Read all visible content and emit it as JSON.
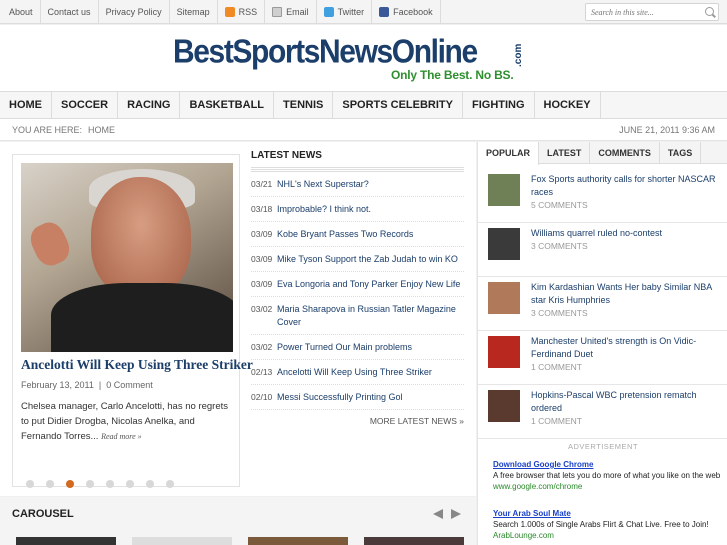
{
  "topnav": {
    "items": [
      "About",
      "Contact us",
      "Privacy Policy",
      "Sitemap"
    ],
    "rss": "RSS",
    "email": "Email",
    "twitter": "Twitter",
    "facebook": "Facebook",
    "search_placeholder": "Search in this site..."
  },
  "logo": {
    "name": "BestSportsNewsOnline",
    "tld": ".com",
    "tagline": "Only The Best. No BS."
  },
  "mainnav": [
    "HOME",
    "SOCCER",
    "RACING",
    "BASKETBALL",
    "TENNIS",
    "SPORTS CELEBRITY",
    "FIGHTING",
    "HOCKEY"
  ],
  "breadcrumb": {
    "label": "YOU ARE HERE:",
    "home": "HOME",
    "date": "JUNE 21, 2011 9:36 AM"
  },
  "featured": {
    "title": "Ancelotti Will Keep Using Three Striker",
    "date": "February 13, 2011",
    "comments": "0 Comment",
    "excerpt": "Chelsea manager, Carlo Ancelotti, has no regrets to put Didier Drogba, Nicolas Anelka, and Fernando Torres...",
    "read_more": "Read more »",
    "dot_count": 8,
    "active_dot": 2
  },
  "latest": {
    "heading": "LATEST NEWS",
    "items": [
      {
        "date": "03/21",
        "title": "NHL's Next Superstar?"
      },
      {
        "date": "03/18",
        "title": "Improbable? I think not."
      },
      {
        "date": "03/09",
        "title": "Kobe Bryant Passes Two Records"
      },
      {
        "date": "03/09",
        "title": "Mike Tyson Support the Zab Judah to win KO"
      },
      {
        "date": "03/09",
        "title": "Eva Longoria and Tony Parker Enjoy New Life"
      },
      {
        "date": "03/02",
        "title": "Maria Sharapova in Russian Tatler Magazine Cover"
      },
      {
        "date": "03/02",
        "title": "Power Turned Our Main problems"
      },
      {
        "date": "02/13",
        "title": "Ancelotti Will Keep Using Three Striker"
      },
      {
        "date": "02/10",
        "title": "Messi Successfully Printing Gol"
      }
    ],
    "more": "MORE LATEST NEWS »"
  },
  "sidebar": {
    "tabs": [
      "POPULAR",
      "LATEST",
      "COMMENTS",
      "TAGS"
    ],
    "popular": [
      {
        "title": "Fox Sports authority calls for shorter NASCAR races",
        "comments": "5 COMMENTS",
        "thumb_color": "#6f7f56"
      },
      {
        "title": "Williams quarrel ruled no-contest",
        "comments": "3 COMMENTS",
        "thumb_color": "#3a3a3a"
      },
      {
        "title": "Kim Kardashian Wants Her baby Similar NBA star Kris Humphries",
        "comments": "3 COMMENTS",
        "thumb_color": "#b07a5a"
      },
      {
        "title": "Manchester United's strength is On Vidic-Ferdinand Duet",
        "comments": "1 COMMENT",
        "thumb_color": "#b8281e"
      },
      {
        "title": "Hopkins-Pascal WBC pretension rematch ordered",
        "comments": "1 COMMENT",
        "thumb_color": "#5a3a2e"
      }
    ],
    "ad_label": "ADVERTISEMENT",
    "ads": [
      {
        "title": "Download Google Chrome",
        "body": "A free browser that lets you do more of what you like on the web",
        "url": "www.google.com/chrome"
      },
      {
        "title": "Your Arab Soul Mate",
        "body": "Search 1.000s of Single Arabs Flirt & Chat Live. Free to Join!",
        "url": "ArabLounge.com"
      }
    ]
  },
  "carousel": {
    "title": "CAROUSEL"
  },
  "colors": {
    "accent": "#1b3e6a",
    "tagline_green": "#2f8f2f",
    "active_dot": "#d2691e",
    "ad_link": "#1a42c8"
  }
}
